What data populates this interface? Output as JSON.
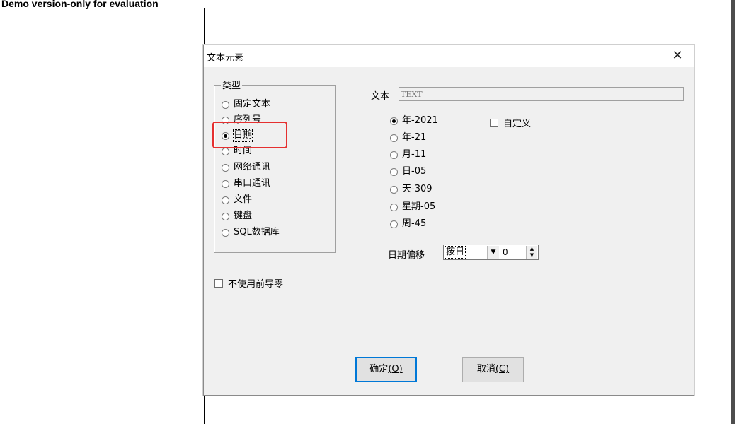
{
  "watermark": "Demo version-only for evaluation",
  "dialog": {
    "title": "文本元素",
    "close_glyph": "✕",
    "type_group": {
      "legend": "类型",
      "options": [
        "固定文本",
        "序列号",
        "日期",
        "时间",
        "网络通讯",
        "串口通讯",
        "文件",
        "键盘",
        "SQL数据库"
      ],
      "selected": "日期"
    },
    "text_label": "文本",
    "text_value": "TEXT",
    "date_formats": {
      "options": [
        "年-2021",
        "年-21",
        "月-11",
        "日-05",
        "天-309",
        "星期-05",
        "周-45"
      ],
      "selected": "年-2021"
    },
    "custom_checkbox": {
      "label": "自定义",
      "checked": false
    },
    "date_offset": {
      "label": "日期偏移",
      "unit_value": "按日",
      "amount_value": "0"
    },
    "no_leading_zero": {
      "label": "不使用前导零",
      "checked": false
    },
    "ok_button": {
      "label": "确定",
      "mnemonic": "(O)"
    },
    "cancel_button": {
      "label": "取消",
      "mnemonic": "(C)"
    }
  },
  "colors": {
    "highlight": "#e53030",
    "dialog_bg": "#f0f0f0",
    "focus_border": "#0078d7"
  }
}
